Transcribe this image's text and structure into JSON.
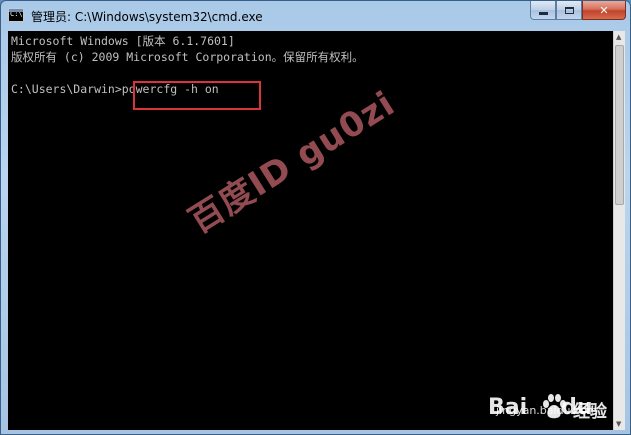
{
  "window": {
    "title": "管理员: C:\\Windows\\system32\\cmd.exe",
    "icon_text": "C:\\",
    "icon": "cmd-console-icon",
    "buttons": {
      "minimize": "minimize-icon",
      "maximize": "maximize-icon",
      "close_label": "✕"
    }
  },
  "console": {
    "lines": [
      "Microsoft Windows [版本 6.1.7601]",
      "版权所有 (c) 2009 Microsoft Corporation。保留所有权利。",
      "",
      "C:\\Users\\Darwin>powercfg -h on"
    ],
    "prompt": "C:\\Users\\Darwin>",
    "command": "powercfg -h on",
    "text_color": "#c0c0c0",
    "background": "#000000",
    "highlight_color": "#d9343a"
  },
  "watermark": {
    "text": "百度ID gu0zi"
  },
  "brand": {
    "name": "Bai",
    "name_suffix": "du",
    "product": "经验",
    "url": "jingyan.baidu.com",
    "paw_icon": "baidu-paw-icon"
  }
}
